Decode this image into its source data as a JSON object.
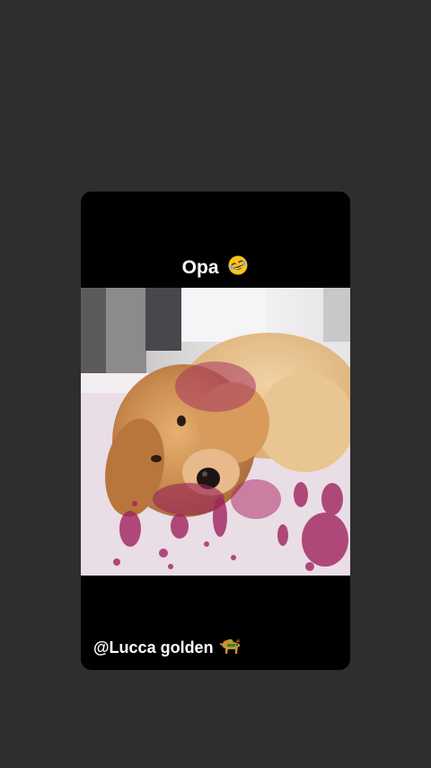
{
  "story": {
    "top_caption": "Opa",
    "top_caption_emoji": "rolling-on-floor-laughing-emoji",
    "bottom_caption": "@Lucca golden",
    "bottom_caption_emoji": "dog-emoji",
    "media_subject": "photo",
    "colors": {
      "background": "#2f2e2f",
      "card": "#000000",
      "text": "#ffffff"
    }
  }
}
